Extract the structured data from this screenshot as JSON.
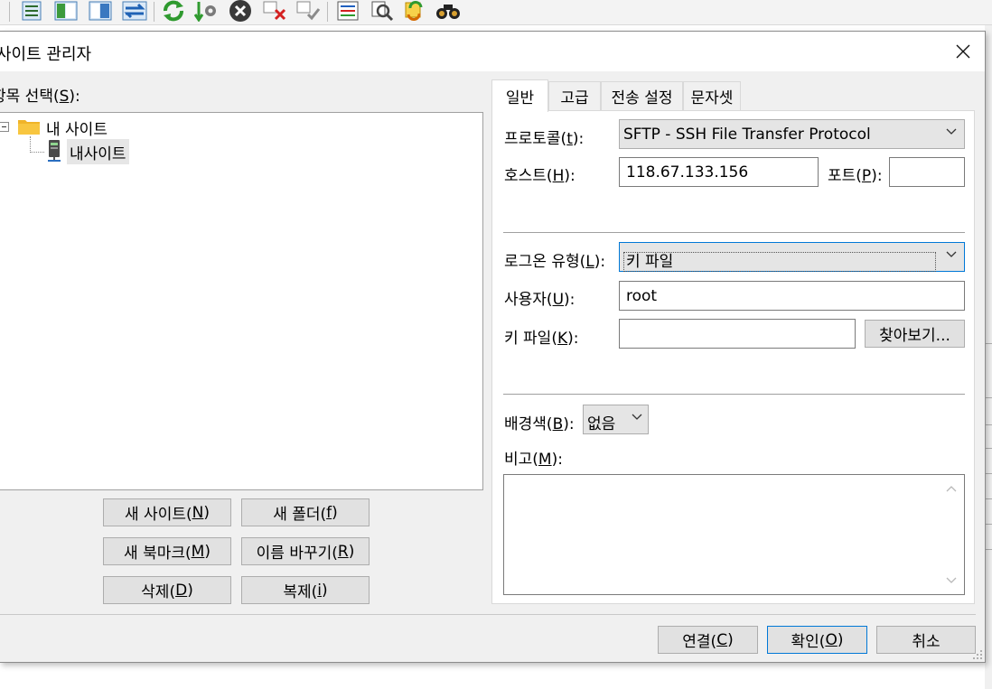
{
  "dialog": {
    "title": "사이트 관리자",
    "select_entry_label": "항목 선택(",
    "select_entry_key": "S",
    "select_entry_suffix": "):"
  },
  "tree": {
    "root_label": "내 사이트",
    "child_label": "내사이트"
  },
  "left_buttons": {
    "new_site": {
      "text": "새 사이트(",
      "key": "N",
      "suffix": ")"
    },
    "new_folder": {
      "text": "새 폴더(",
      "key": "f",
      "suffix": ")"
    },
    "new_bookmark": {
      "text": "새 북마크(",
      "key": "M",
      "suffix": ")"
    },
    "rename": {
      "text": "이름 바꾸기(",
      "key": "R",
      "suffix": ")"
    },
    "delete": {
      "text": "삭제(",
      "key": "D",
      "suffix": ")"
    },
    "duplicate": {
      "text": "복제(",
      "key": "i",
      "suffix": ")"
    }
  },
  "tabs": [
    "일반",
    "고급",
    "전송 설정",
    "문자셋"
  ],
  "general": {
    "protocol": {
      "label": "프로토콜(",
      "key": "t",
      "suffix": "):",
      "value": "SFTP - SSH File Transfer Protocol"
    },
    "host": {
      "label": "호스트(",
      "key": "H",
      "suffix": "):",
      "value": "118.67.133.156"
    },
    "port": {
      "label": "포트(",
      "key": "P",
      "suffix": "):",
      "value": ""
    },
    "logon_type": {
      "label": "로그온 유형(",
      "key": "L",
      "suffix": "):",
      "value": "키 파일"
    },
    "user": {
      "label": "사용자(",
      "key": "U",
      "suffix": "):",
      "value": "root"
    },
    "key_file": {
      "label": "키 파일(",
      "key": "K",
      "suffix": "):",
      "value": ""
    },
    "browse_button": "찾아보기...",
    "background_color": {
      "label": "배경색(",
      "key": "B",
      "suffix": "):",
      "value": "없음"
    },
    "comments": {
      "label": "비고(",
      "key": "M",
      "suffix": "):",
      "value": ""
    }
  },
  "bottom_buttons": {
    "connect": {
      "text": "연결(",
      "key": "C",
      "suffix": ")"
    },
    "ok": {
      "text": "확인(",
      "key": "O",
      "suffix": ")"
    },
    "cancel": {
      "text": "취소"
    }
  }
}
